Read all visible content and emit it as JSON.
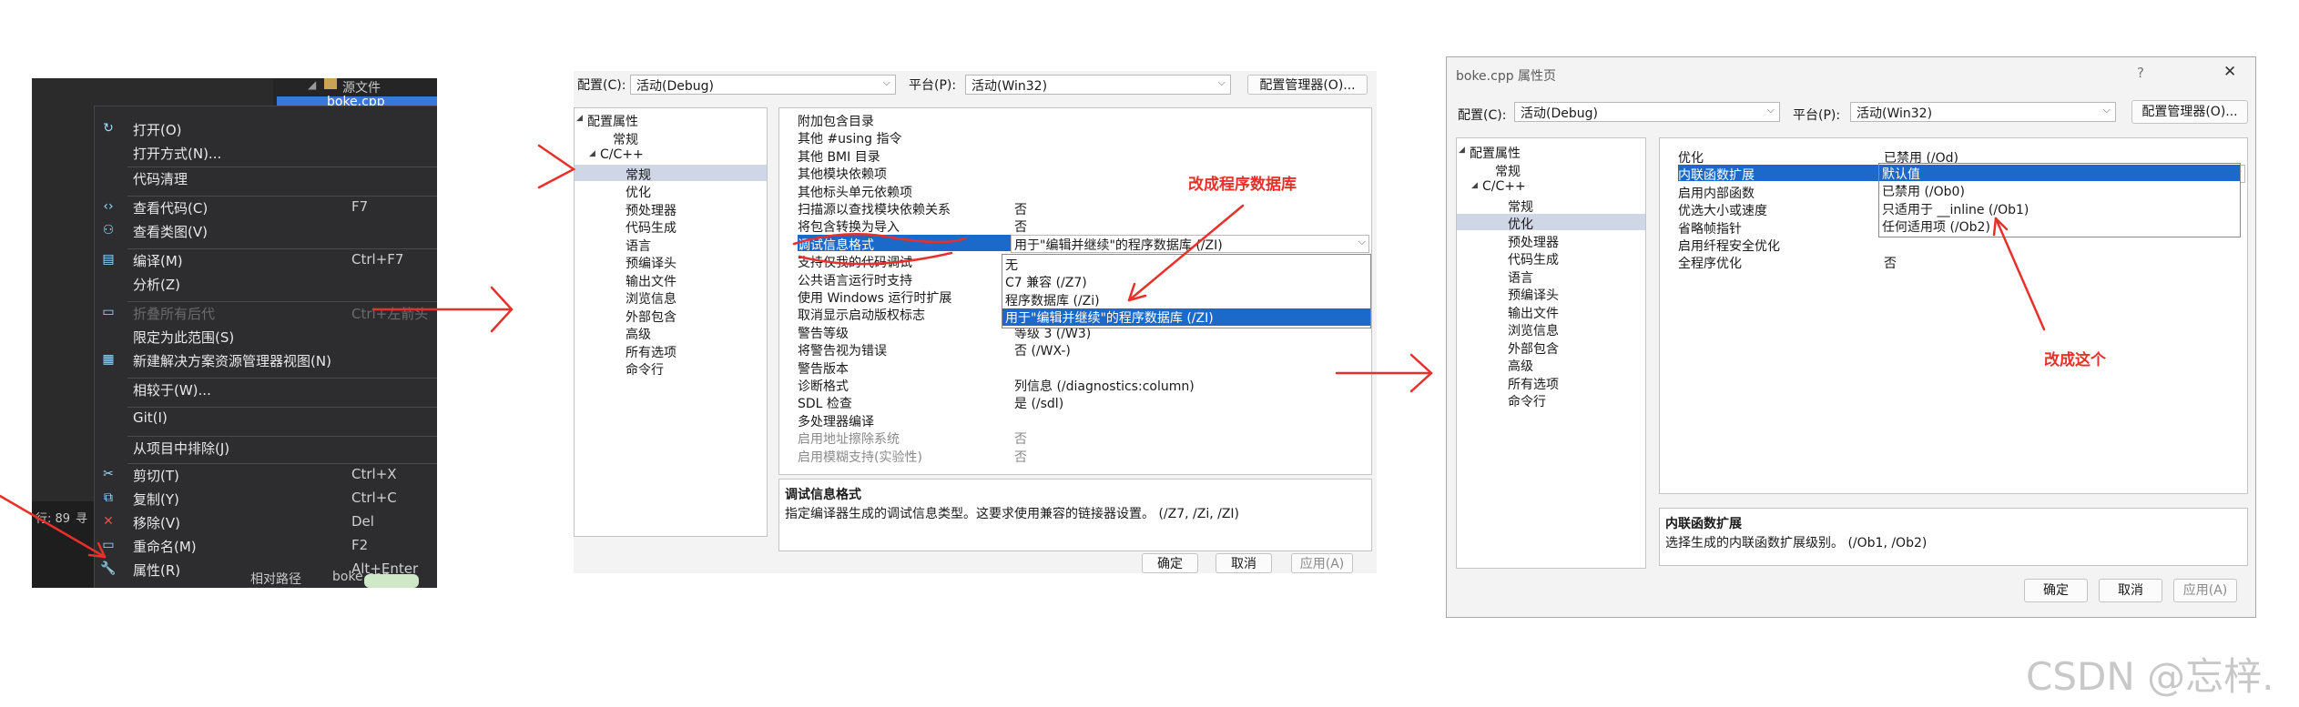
{
  "panel1": {
    "tree_folder": "源文件",
    "tree_file": "boke.cpp",
    "menu": [
      {
        "icon": "open-icon",
        "label": "打开(O)",
        "shortcut": ""
      },
      {
        "icon": "",
        "label": "打开方式(N)...",
        "shortcut": ""
      },
      {
        "icon": "",
        "label": "代码清理",
        "shortcut": "",
        "submenu": true
      },
      {
        "icon": "code-icon",
        "label": "查看代码(C)",
        "shortcut": "F7"
      },
      {
        "icon": "class-diagram-icon",
        "label": "查看类图(V)",
        "shortcut": ""
      },
      {
        "icon": "compile-icon",
        "label": "编译(M)",
        "shortcut": "Ctrl+F7"
      },
      {
        "icon": "",
        "label": "分析(Z)",
        "shortcut": "",
        "submenu": true
      },
      {
        "icon": "collapse-icon",
        "label": "折叠所有后代",
        "shortcut": "Ctrl+左箭头",
        "disabled": true
      },
      {
        "icon": "",
        "label": "限定为此范围(S)",
        "shortcut": ""
      },
      {
        "icon": "new-view-icon",
        "label": "新建解决方案资源管理器视图(N)",
        "shortcut": ""
      },
      {
        "icon": "",
        "label": "相较于(W)...",
        "shortcut": ""
      },
      {
        "icon": "",
        "label": "Git(I)",
        "shortcut": "",
        "submenu": true
      },
      {
        "icon": "",
        "label": "从项目中排除(J)",
        "shortcut": ""
      },
      {
        "icon": "cut-icon",
        "label": "剪切(T)",
        "shortcut": "Ctrl+X"
      },
      {
        "icon": "copy-icon",
        "label": "复制(Y)",
        "shortcut": "Ctrl+C"
      },
      {
        "icon": "remove-icon",
        "label": "移除(V)",
        "shortcut": "Del"
      },
      {
        "icon": "rename-icon",
        "label": "重命名(M)",
        "shortcut": "F2"
      },
      {
        "icon": "wrench-icon",
        "label": "属性(R)",
        "shortcut": "Alt+Enter"
      }
    ],
    "status_left": "行: 89",
    "status_left_extra": "寻",
    "bottom_label": "相对路径",
    "bottom_value": "boke.cpp"
  },
  "panel2": {
    "config_label": "配置(C):",
    "config_value": "活动(Debug)",
    "platform_label": "平台(P):",
    "platform_value": "活动(Win32)",
    "config_manager": "配置管理器(O)...",
    "tree": [
      "配置属性",
      "常规",
      "C/C++",
      "常规",
      "优化",
      "预处理器",
      "代码生成",
      "语言",
      "预编译头",
      "输出文件",
      "浏览信息",
      "外部包含",
      "高级",
      "所有选项",
      "命令行"
    ],
    "props": [
      {
        "k": "附加包含目录",
        "v": ""
      },
      {
        "k": "其他 #using 指令",
        "v": ""
      },
      {
        "k": "其他 BMI 目录",
        "v": ""
      },
      {
        "k": "其他模块依赖项",
        "v": ""
      },
      {
        "k": "其他标头单元依赖项",
        "v": ""
      },
      {
        "k": "扫描源以查找模块依赖关系",
        "v": "否"
      },
      {
        "k": "将包含转换为导入",
        "v": "否"
      },
      {
        "k": "调试信息格式",
        "v": "用于\"编辑并继续\"的程序数据库 (/ZI)"
      },
      {
        "k": "支持仅我的代码调试",
        "v": ""
      },
      {
        "k": "公共语言运行时支持",
        "v": ""
      },
      {
        "k": "使用 Windows 运行时扩展",
        "v": ""
      },
      {
        "k": "取消显示启动版权标志",
        "v": ""
      },
      {
        "k": "警告等级",
        "v": "等级 3 (/W3)"
      },
      {
        "k": "将警告视为错误",
        "v": "否 (/WX-)"
      },
      {
        "k": "警告版本",
        "v": ""
      },
      {
        "k": "诊断格式",
        "v": "列信息 (/diagnostics:column)"
      },
      {
        "k": "SDL 检查",
        "v": "是 (/sdl)"
      },
      {
        "k": "多处理器编译",
        "v": ""
      },
      {
        "k": "启用地址擦除系统",
        "v": "否"
      },
      {
        "k": "启用模糊支持(实验性)",
        "v": "否"
      }
    ],
    "dropdown": [
      "无",
      "C7 兼容 (/Z7)",
      "程序数据库 (/Zi)",
      "用于\"编辑并继续\"的程序数据库 (/ZI)"
    ],
    "annotation": "改成程序数据库",
    "desc_title": "调试信息格式",
    "desc_text": "指定编译器生成的调试信息类型。这要求使用兼容的链接器设置。  (/Z7, /Zi, /ZI)",
    "ok": "确定",
    "cancel": "取消",
    "apply": "应用(A)"
  },
  "panel3": {
    "title": "boke.cpp 属性页",
    "help": "?",
    "close": "✕",
    "config_label": "配置(C):",
    "config_value": "活动(Debug)",
    "platform_label": "平台(P):",
    "platform_value": "活动(Win32)",
    "config_manager": "配置管理器(O)...",
    "tree": [
      "配置属性",
      "常规",
      "C/C++",
      "常规",
      "优化",
      "预处理器",
      "代码生成",
      "语言",
      "预编译头",
      "输出文件",
      "浏览信息",
      "外部包含",
      "高级",
      "所有选项",
      "命令行"
    ],
    "props": [
      {
        "k": "优化",
        "v": "已禁用 (/Od)"
      },
      {
        "k": "内联函数扩展",
        "v": "默认值"
      },
      {
        "k": "启用内部函数",
        "v": ""
      },
      {
        "k": "优选大小或速度",
        "v": ""
      },
      {
        "k": "省略帧指针",
        "v": ""
      },
      {
        "k": "启用纤程安全优化",
        "v": ""
      },
      {
        "k": "全程序优化",
        "v": "否"
      }
    ],
    "dropdown": [
      "默认值",
      "已禁用 (/Ob0)",
      "只适用于 __inline (/Ob1)",
      "任何适用项 (/Ob2)"
    ],
    "annotation": "改成这个",
    "desc_title": "内联函数扩展",
    "desc_text": "选择生成的内联函数扩展级别。   (/Ob1, /Ob2)",
    "ok": "确定",
    "cancel": "取消",
    "apply": "应用(A)"
  },
  "watermark": "CSDN @忘梓.",
  "colors": {
    "highlight": "#1b6ac9",
    "annotation": "#e8302a",
    "menu_bg": "#2d2d30"
  }
}
